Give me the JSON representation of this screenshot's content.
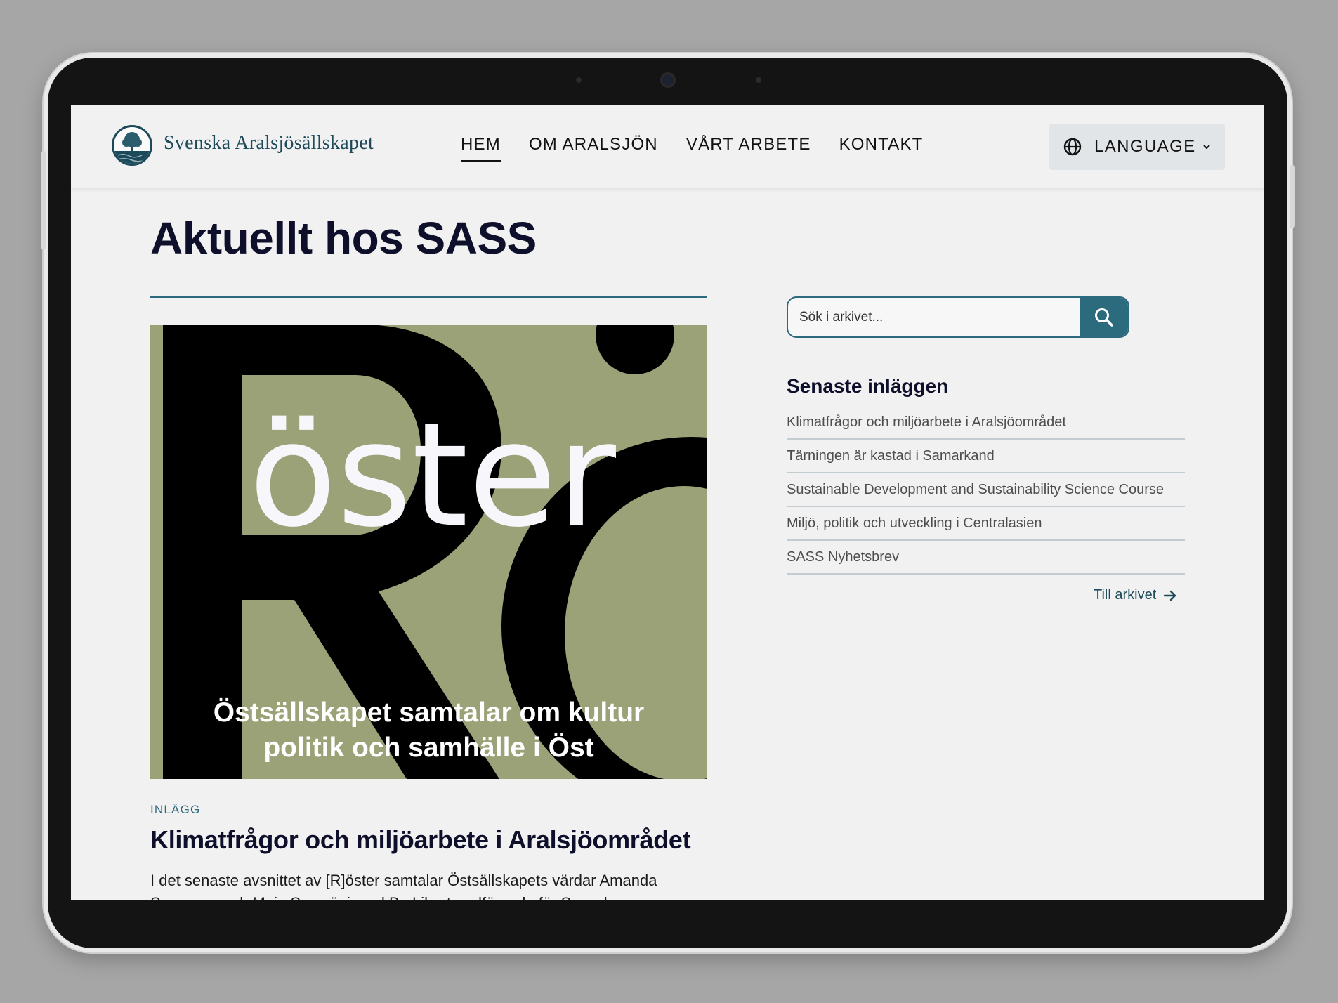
{
  "header": {
    "site_name": "Svenska Aralsjösällskapet",
    "nav": [
      {
        "label": "HEM",
        "active": true
      },
      {
        "label": "OM ARALSJÖN",
        "active": false
      },
      {
        "label": "VÅRT ARBETE",
        "active": false
      },
      {
        "label": "KONTAKT",
        "active": false
      }
    ],
    "language_label": "LANGUAGE"
  },
  "main": {
    "page_title": "Aktuellt hos SASS",
    "feature_image": {
      "big_word": "öster",
      "subtitle_line1": "Östsällskapet samtalar om kultur",
      "subtitle_line2": "politik och samhälle i Öst"
    },
    "post": {
      "category": "INLÄGG",
      "title": "Klimatfrågor och miljöarbete i Aralsjöområdet",
      "excerpt_line1": "I det senaste avsnittet av [R]öster samtalar Östsällskapets värdar Amanda",
      "excerpt_line2": "Sanesson och Maja Szemägi med Bo Libert, ordförande för Svenska"
    }
  },
  "sidebar": {
    "search_placeholder": "Sök i arkivet...",
    "recent_heading": "Senaste inläggen",
    "recent_posts": [
      "Klimatfrågor och miljöarbete i Aralsjöområdet",
      "Tärningen är kastad i Samarkand",
      "Sustainable Development and Sustainability Science Course",
      "Miljö, politik och utveckling i Centralasien",
      "SASS Nyhetsbrev"
    ],
    "archive_link": "Till arkivet"
  },
  "colors": {
    "accent": "#2c6a7e",
    "heading": "#0e0f2a",
    "feature_bg": "#9ca278"
  },
  "icons": [
    "globe-icon",
    "chevron-down-icon",
    "search-icon",
    "arrow-right-icon",
    "tree-logo-icon"
  ]
}
